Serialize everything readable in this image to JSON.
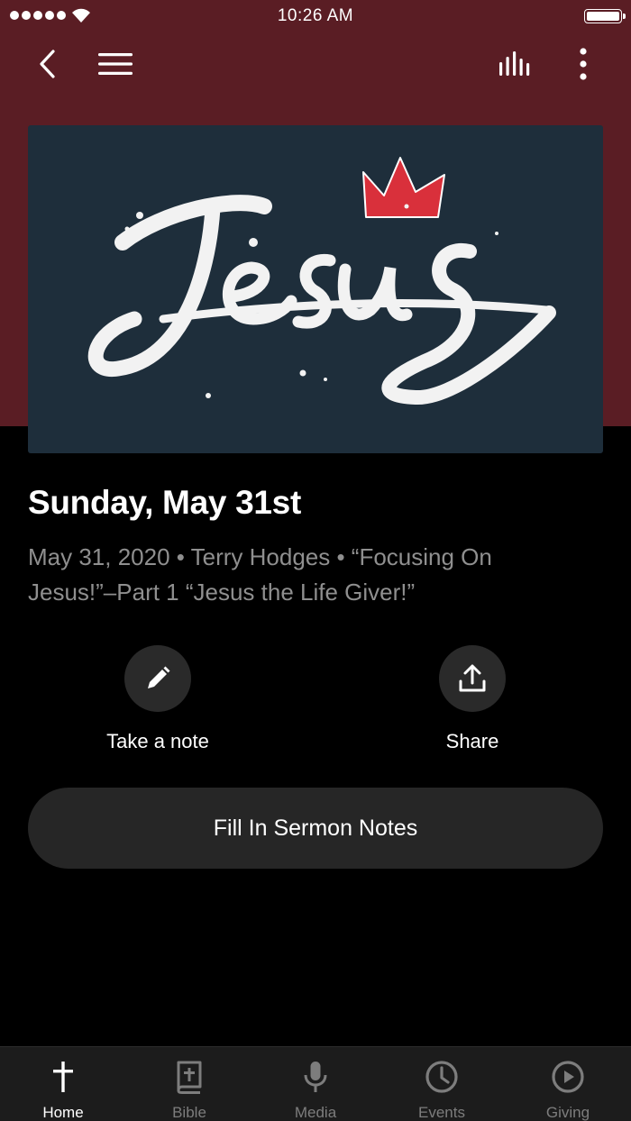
{
  "status_bar": {
    "time": "10:26 AM",
    "signal_icon": "signal-dots-icon",
    "wifi_icon": "wifi-icon",
    "battery_icon": "battery-icon"
  },
  "nav": {
    "back_icon": "chevron-left-icon",
    "menu_icon": "hamburger-menu-icon",
    "audio_icon": "audio-bars-icon",
    "more_icon": "vertical-dots-icon"
  },
  "artwork": {
    "word": "Jesus",
    "background": "#1e2e3b",
    "crown_color": "#d9303b"
  },
  "sermon": {
    "title": "Sunday, May 31st",
    "meta": "May 31, 2020 • Terry Hodges • “Focusing On Jesus!”–Part 1 “Jesus the Life Giver!”"
  },
  "actions": {
    "note": {
      "label": "Take a note",
      "icon": "pencil-icon"
    },
    "share": {
      "label": "Share",
      "icon": "upload-icon"
    }
  },
  "sermon_notes_button": "Fill In Sermon Notes",
  "tabs": [
    {
      "label": "Home",
      "icon": "cross-icon",
      "active": true
    },
    {
      "label": "Bible",
      "icon": "bible-icon",
      "active": false
    },
    {
      "label": "Media",
      "icon": "microphone-icon",
      "active": false
    },
    {
      "label": "Events",
      "icon": "clock-icon",
      "active": false
    },
    {
      "label": "Giving",
      "icon": "play-circle-icon",
      "active": false
    }
  ],
  "colors": {
    "header": "#5a1d24",
    "background": "#000000",
    "button": "#262626",
    "inactive_tab": "#7d7d7d"
  }
}
